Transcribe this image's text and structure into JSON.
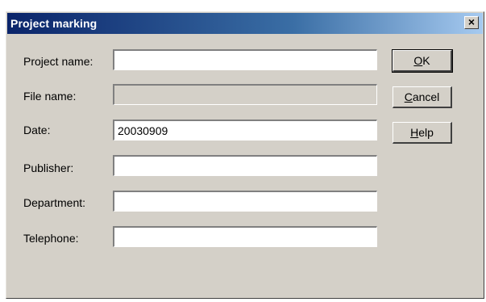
{
  "window": {
    "title": "Project marking",
    "close_glyph": "×"
  },
  "fields": [
    {
      "label": "Project name:",
      "value": "",
      "enabled": true
    },
    {
      "label": "File name:",
      "value": "",
      "enabled": false
    },
    {
      "label": "Date:",
      "value": "20030909",
      "enabled": true
    },
    {
      "label": "Publisher:",
      "value": "",
      "enabled": true
    },
    {
      "label": "Department:",
      "value": "",
      "enabled": true
    },
    {
      "label": "Telephone:",
      "value": "",
      "enabled": true
    }
  ],
  "buttons": {
    "ok": {
      "mnemonic": "O",
      "rest": "K"
    },
    "cancel": {
      "mnemonic": "C",
      "rest": "ancel"
    },
    "help": {
      "mnemonic": "H",
      "rest": "elp"
    }
  },
  "colors": {
    "dialog_face": "#d4d0c8",
    "title_start": "#0a246a",
    "title_end": "#a6caf0"
  },
  "icons": [
    "close-icon"
  ]
}
